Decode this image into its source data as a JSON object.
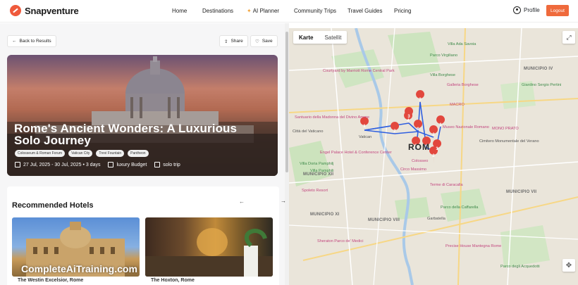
{
  "brand": {
    "name": "Snapventure",
    "accent": "#ef5a3c"
  },
  "nav": {
    "home": "Home",
    "destinations": "Destinations",
    "ai_planner": "AI Planner",
    "community": "Community Trips",
    "guides": "Travel Guides",
    "pricing": "Pricing",
    "profile": "Profile",
    "logout": "Logout"
  },
  "actions": {
    "back": "Back to Results",
    "share": "Share",
    "save": "Save"
  },
  "trip": {
    "title": "Rome's Ancient Wonders: A Luxurious Solo Journey",
    "tags": [
      "Colosseum & Roman Forum",
      "Vatican City",
      "Trevi Fountain",
      "Pantheon"
    ],
    "dates": "27 Jul, 2025 - 30 Jul, 2025 • 3 days",
    "budget": "luxury Budget",
    "group": "solo trip"
  },
  "hotels": {
    "title": "Recommended Hotels",
    "watermark": "CompleteAiTraining.com",
    "items": [
      {
        "name": "The Westin Excelsior, Rome"
      },
      {
        "name": "The Hoxton, Rome"
      }
    ]
  },
  "map": {
    "tabs": [
      "Karte",
      "Satellit"
    ],
    "city": "ROM",
    "labels": [
      "Courtyard by Marriott Rome Central Park",
      "Villa Borghese",
      "Galleria Borghese",
      "Giardino Sergio Pertini",
      "MUNICIPIO IV",
      "Villa Ada Savoia",
      "Parco Virgiliano",
      "MACRO",
      "Cimitero Monumentale del Verano",
      "Museo Nazionale Romano",
      "Vatican",
      "Città del Vaticano",
      "Santuario della Madonna del Divino Amore",
      "Colosseo",
      "Circo Massimo",
      "Terme di Caracalla",
      "Parco della Caffarella",
      "MUNICIPIO VII",
      "MUNICIPIO XII",
      "MUNICIPIO VIII",
      "Garbatella",
      "Precise House Mantegna Rome",
      "Parco degli Acquedotti",
      "MONO PRATO",
      "Villa Doria Pamphilj",
      "Engel Palace Hotel & Conference Center",
      "Villa Pamphili",
      "Sheraton Parco de' Medici",
      "Spoleto Resort",
      "MUNICIPIO XI"
    ]
  }
}
